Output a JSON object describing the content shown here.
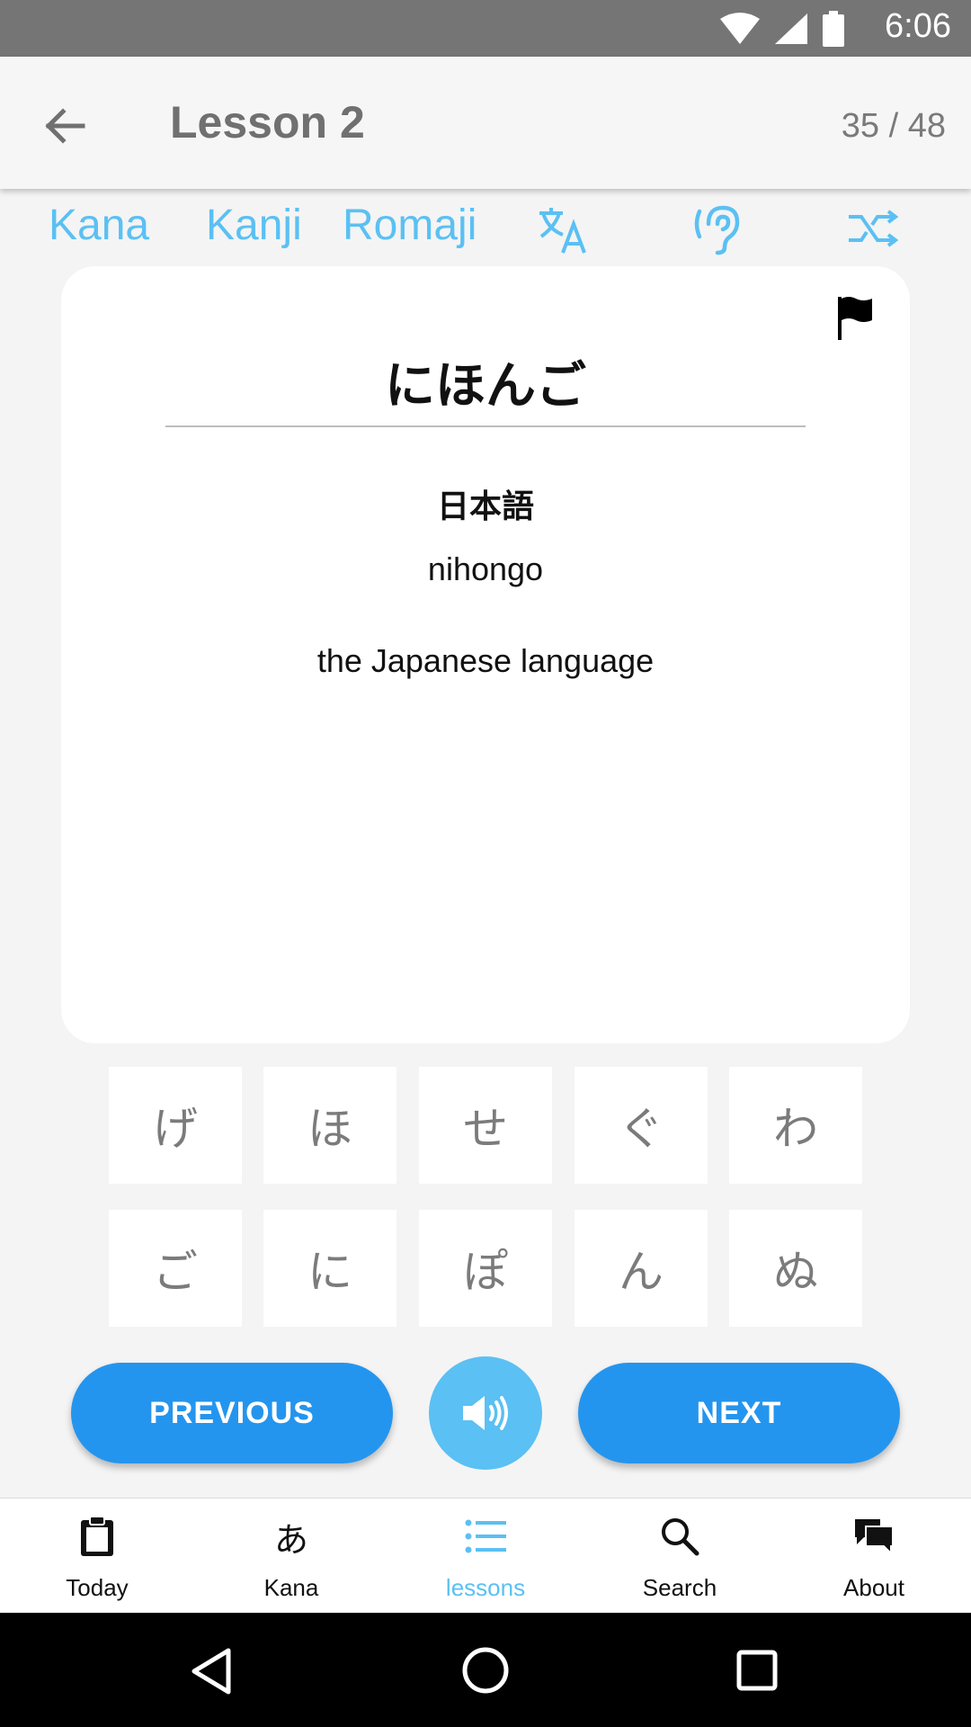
{
  "status_bar": {
    "time": "6:06"
  },
  "header": {
    "title": "Lesson 2",
    "counter": "35 / 48"
  },
  "modes": {
    "kana": "Kana",
    "kanji": "Kanji",
    "romaji": "Romaji"
  },
  "card": {
    "kana": "にほんご",
    "kanji": "日本語",
    "romaji": "nihongo",
    "meaning": "the Japanese language"
  },
  "keys": {
    "row1": [
      "げ",
      "ほ",
      "せ",
      "ぐ",
      "わ"
    ],
    "row2": [
      "ご",
      "に",
      "ぽ",
      "ん",
      "ぬ"
    ]
  },
  "actions": {
    "previous": "PREVIOUS",
    "next": "NEXT"
  },
  "bottom_nav": {
    "items": [
      {
        "label": "Today",
        "icon": "clipboard-icon",
        "active": false
      },
      {
        "label": "Kana",
        "icon": "a-char-icon",
        "glyph": "あ",
        "active": false
      },
      {
        "label": "lessons",
        "icon": "list-icon",
        "active": true
      },
      {
        "label": "Search",
        "icon": "search-icon",
        "active": false
      },
      {
        "label": "About",
        "icon": "chat-icon",
        "active": false
      }
    ]
  },
  "colors": {
    "accent": "#5bc0f3",
    "primary_button": "#2495ee",
    "status_bar": "#757575"
  }
}
